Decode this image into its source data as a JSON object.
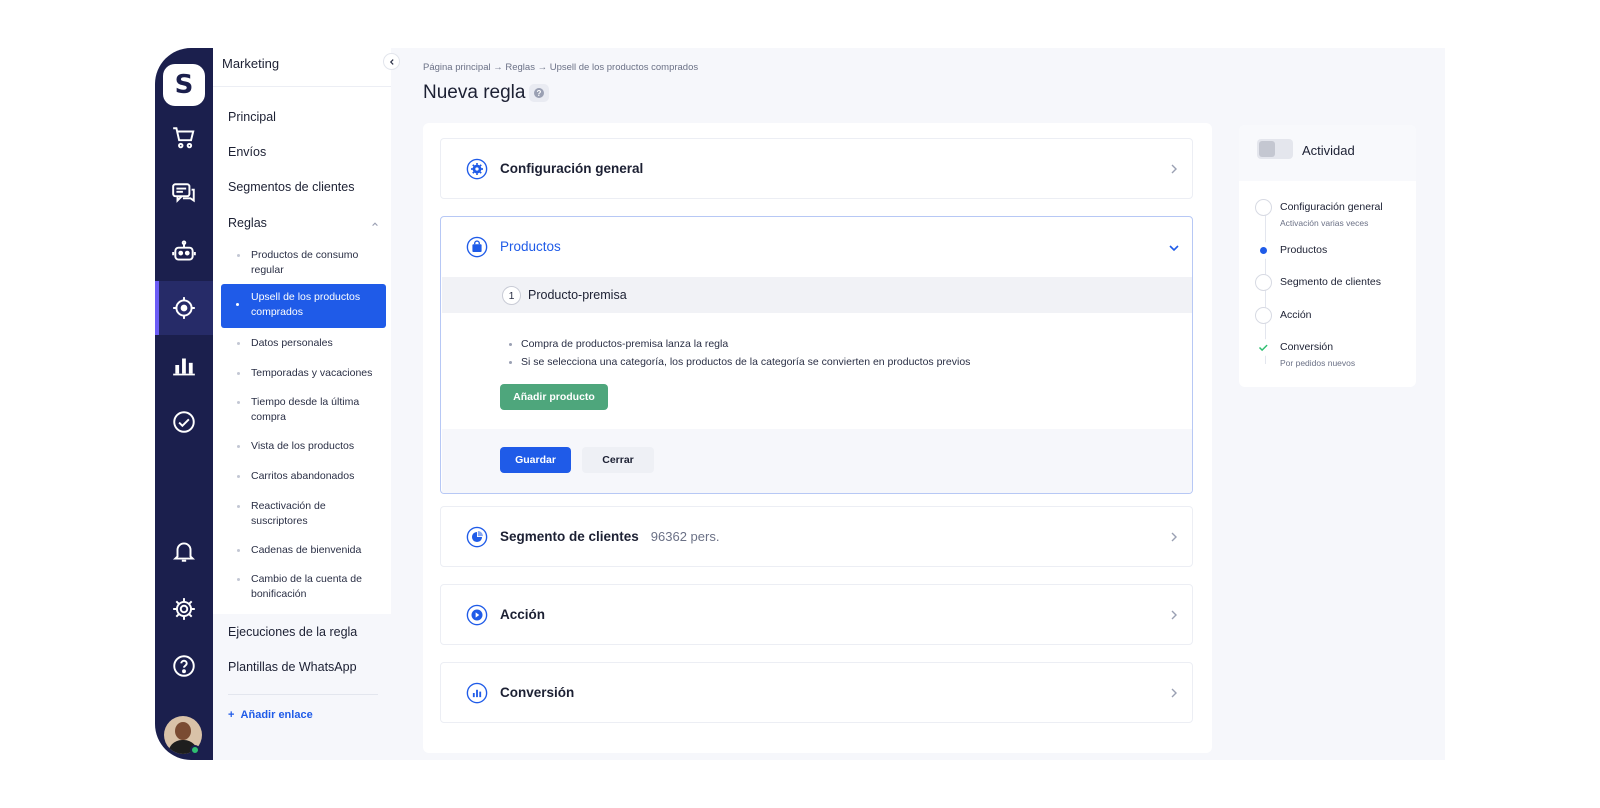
{
  "sidebar": {
    "section_title": "Marketing",
    "items": [
      {
        "label": "Principal"
      },
      {
        "label": "Envíos"
      },
      {
        "label": "Segmentos de clientes"
      },
      {
        "label": "Reglas"
      }
    ],
    "rules_subitems": [
      {
        "label": "Productos de consumo regular"
      },
      {
        "label": "Upsell de los productos comprados",
        "active": true
      },
      {
        "label": "Datos personales"
      },
      {
        "label": "Temporadas y vacaciones"
      },
      {
        "label": "Tiempo desde la última compra"
      },
      {
        "label": "Vista de los productos"
      },
      {
        "label": "Carritos abandonados"
      },
      {
        "label": "Reactivación de suscriptores"
      },
      {
        "label": "Cadenas de bienvenida"
      },
      {
        "label": "Cambio de la cuenta de bonificación"
      }
    ],
    "bottom_items": [
      {
        "label": "Ejecuciones de la regla"
      },
      {
        "label": "Plantillas de WhatsApp"
      }
    ],
    "add_link": "Añadir enlace"
  },
  "rail": {
    "logo": "S",
    "icons": [
      "cart-icon",
      "chat-icon",
      "robot-icon",
      "target-icon",
      "bar-chart-icon",
      "check-circle-icon",
      "bell-icon",
      "gear-icon",
      "question-icon"
    ],
    "active": "target-icon"
  },
  "header": {
    "breadcrumb": "Página principal → Reglas → Upsell de los productos comprados",
    "title": "Nueva regla",
    "help": "?"
  },
  "sections": {
    "general": {
      "title": "Configuración general"
    },
    "products": {
      "title": "Productos",
      "premise_number": "1",
      "premise_title": "Producto-premisa",
      "bullets": [
        "Compra de productos-premisa lanza la regla",
        "Si se selecciona una categoría, los productos de la categoría se convierten en productos previos"
      ],
      "add_button": "Añadir producto",
      "save_button": "Guardar",
      "close_button": "Cerrar"
    },
    "segment": {
      "title": "Segmento de clientes",
      "meta": "96362 pers."
    },
    "action": {
      "title": "Acción"
    },
    "conversion": {
      "title": "Conversión"
    }
  },
  "status": {
    "label": "Actividad",
    "steps": [
      {
        "label": "Configuración general",
        "sub": "Activación varias veces",
        "state": "empty"
      },
      {
        "label": "Productos",
        "sub": "",
        "state": "current"
      },
      {
        "label": "Segmento de clientes",
        "sub": "",
        "state": "empty"
      },
      {
        "label": "Acción",
        "sub": "",
        "state": "empty"
      },
      {
        "label": "Conversión",
        "sub": "Por pedidos nuevos",
        "state": "done"
      }
    ]
  },
  "colors": {
    "rail_bg": "#1b1f4d",
    "accent_blue": "#1f5be8",
    "green_button": "#4ea67c",
    "rail_active_marker": "#6b5cf5"
  }
}
